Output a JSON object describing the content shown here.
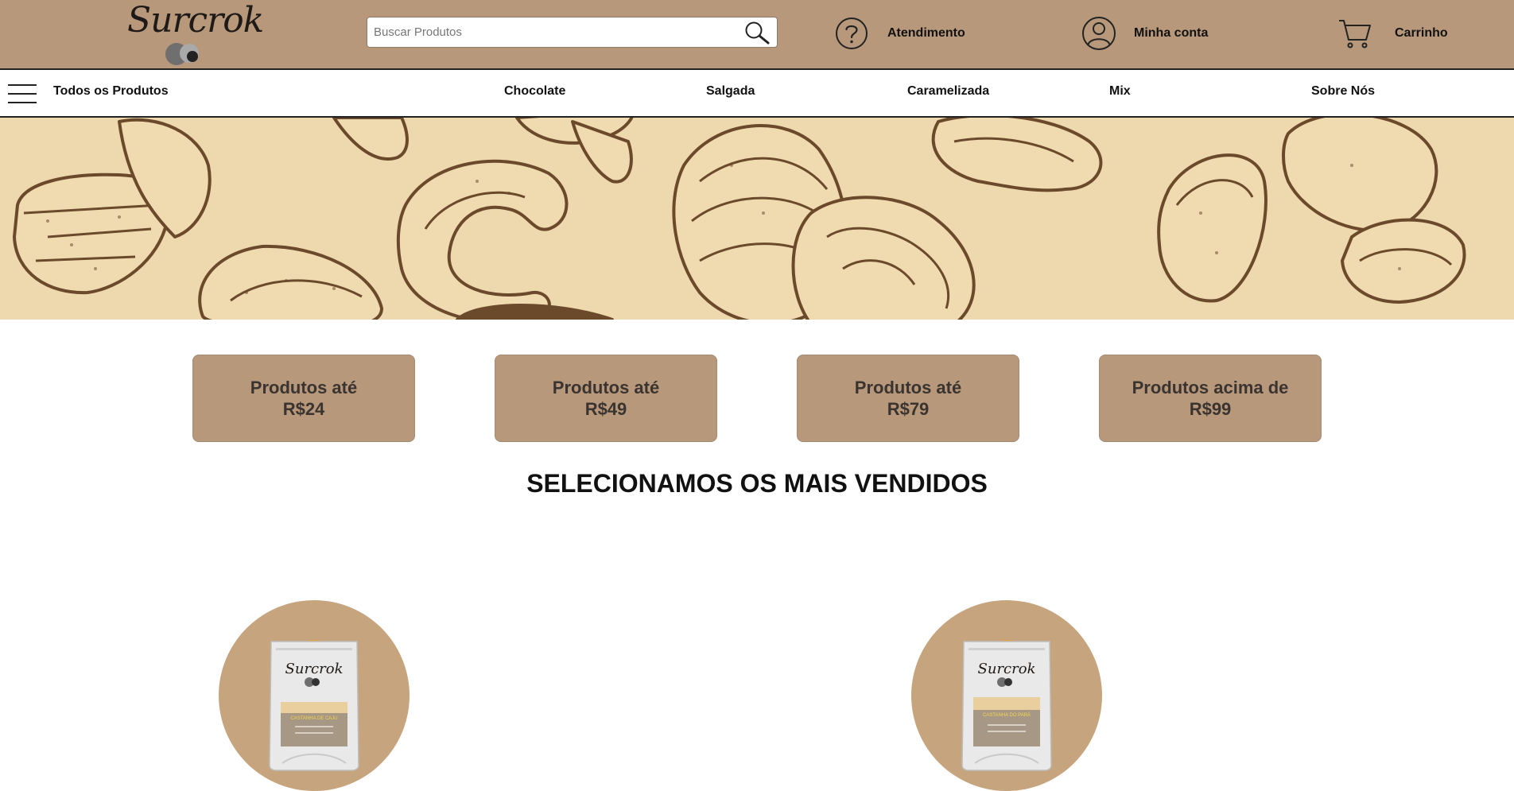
{
  "logo": {
    "text": "Surcrok"
  },
  "search": {
    "placeholder": "Buscar Produtos"
  },
  "header": {
    "support_label": "Atendimento",
    "account_label": "Minha conta",
    "cart_label": "Carrinho"
  },
  "nav": {
    "all_products": "Todos os Produtos",
    "items": [
      "Chocolate",
      "Salgada",
      "Caramelizada",
      "Mix",
      "Sobre Nós"
    ]
  },
  "price_filters": [
    {
      "line1": "Produtos até",
      "line2": "R$24"
    },
    {
      "line1": "Produtos até",
      "line2": "R$49"
    },
    {
      "line1": "Produtos até",
      "line2": "R$79"
    },
    {
      "line1": "Produtos acima de",
      "line2": "R$99"
    }
  ],
  "bestsellers": {
    "title": "SELECIONAMOS OS MAIS VENDIDOS",
    "products": [
      {
        "package_brand": "Surcrok",
        "package_label": "CASTANHA DE CAJU"
      },
      {
        "package_brand": "Surcrok",
        "package_label": "CASTANHA DO PARÁ"
      }
    ]
  },
  "colors": {
    "header_bg": "#b8987a",
    "banner_bg": "#eed8ad",
    "nut_ink": "#6b4a2b",
    "product_circle": "#c6a47d"
  },
  "icons": {
    "search": "magnifier-icon",
    "support": "question-circle-icon",
    "account": "user-circle-icon",
    "cart": "cart-icon",
    "menu": "hamburger-icon"
  }
}
